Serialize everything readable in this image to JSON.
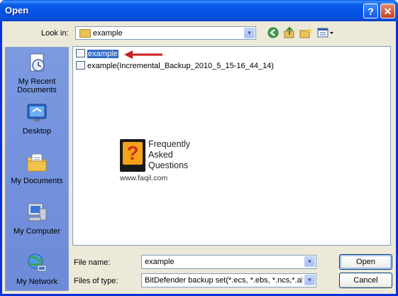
{
  "window": {
    "title": "Open",
    "help_symbol": "?",
    "close_symbol": "✕"
  },
  "toolbar": {
    "lookin_label": "Look in:",
    "lookin_value": "example",
    "icons": [
      "back-icon",
      "up-folder-icon",
      "new-folder-icon",
      "views-menu-icon"
    ]
  },
  "places": [
    {
      "label": "My Recent Documents",
      "icon": "recent-documents-icon"
    },
    {
      "label": "Desktop",
      "icon": "desktop-icon"
    },
    {
      "label": "My Documents",
      "icon": "my-documents-icon"
    },
    {
      "label": "My Computer",
      "icon": "my-computer-icon"
    },
    {
      "label": "My Network",
      "icon": "my-network-icon"
    }
  ],
  "files": [
    {
      "name": "example",
      "selected": true
    },
    {
      "name": "example(Incremental_Backup_2010_5_15-16_44_14)",
      "selected": false
    }
  ],
  "watermark": {
    "line1": "Frequently",
    "line2": "Asked",
    "line3": "Questions",
    "url": "www.faqil.com",
    "logo_glyph": "?"
  },
  "footer": {
    "filename_label": "File name:",
    "filename_value": "example",
    "filetype_label": "Files of type:",
    "filetype_value": "BitDefender backup set(*.ecs, *.ebs, *.ncs,*.ab",
    "open_label": "Open",
    "cancel_label": "Cancel"
  },
  "colors": {
    "accent": "#316ac5",
    "arrow": "#c8201e",
    "title_bar": "#0a5fe8"
  }
}
